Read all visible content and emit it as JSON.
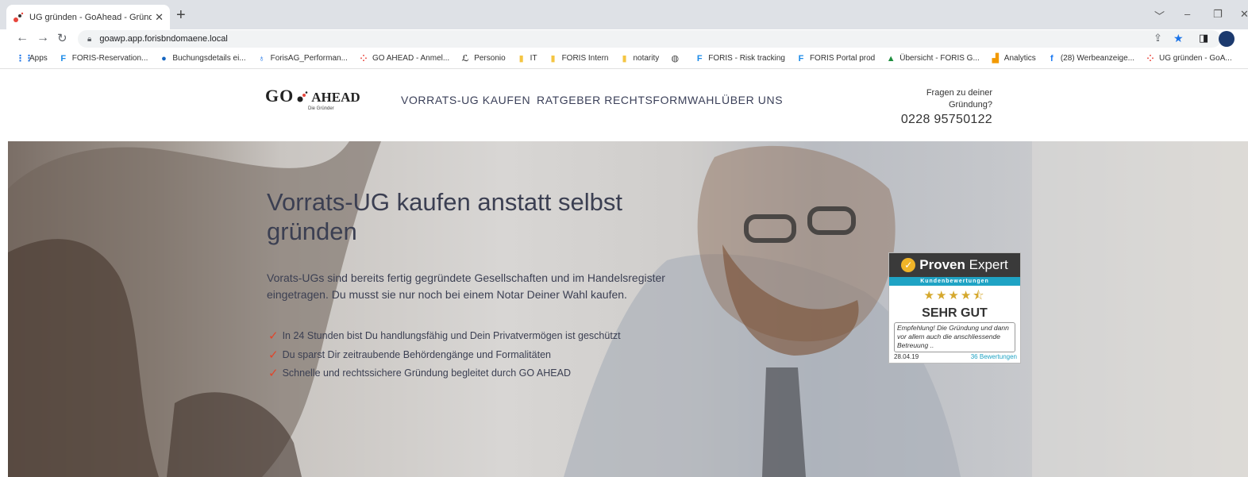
{
  "browser": {
    "tab_title": "UG gründen - GoAhead - Gründ",
    "tab_close": "✕",
    "new_tab": "+",
    "url": "goawp.app.forisbndomaene.local",
    "window_controls": [
      "﹀",
      "–",
      "❐",
      "✕"
    ]
  },
  "bookmarks": [
    {
      "label": "Apps",
      "icon": "apps-grid-icon",
      "color": "#1a73e8",
      "glyph": "⋮⋮"
    },
    {
      "label": "FORIS-Reservation...",
      "icon": "foris-f-icon",
      "color": "#1a8ae8",
      "glyph": "F"
    },
    {
      "label": "Buchungsdetails ei...",
      "icon": "blue-circle-icon",
      "color": "#1565c0",
      "glyph": "●"
    },
    {
      "label": "ForisAG_Performan...",
      "icon": "figure-icon",
      "color": "#1a73e8",
      "glyph": "♁"
    },
    {
      "label": "GO AHEAD - Anmel...",
      "icon": "goahead-dots-icon",
      "color": "#e8453c",
      "glyph": "⁘"
    },
    {
      "label": "Personio",
      "icon": "personio-icon",
      "color": "#444444",
      "glyph": "ℒ"
    },
    {
      "label": "IT",
      "icon": "folder-icon",
      "color": "#f4c542",
      "glyph": "▮"
    },
    {
      "label": "FORIS Intern",
      "icon": "folder-icon",
      "color": "#f4c542",
      "glyph": "▮"
    },
    {
      "label": "notarity",
      "icon": "folder-icon",
      "color": "#f4c542",
      "glyph": "▮"
    },
    {
      "label": "",
      "icon": "globe-icon",
      "color": "#444444",
      "glyph": "◍"
    },
    {
      "label": "FORIS - Risk tracking",
      "icon": "foris-f-icon",
      "color": "#1a8ae8",
      "glyph": "F"
    },
    {
      "label": "FORIS Portal prod",
      "icon": "foris-f-icon",
      "color": "#1a8ae8",
      "glyph": "F"
    },
    {
      "label": "Übersicht - FORIS G...",
      "icon": "drive-icon",
      "color": "#1e8e3e",
      "glyph": "▲"
    },
    {
      "label": "Analytics",
      "icon": "analytics-icon",
      "color": "#f29900",
      "glyph": "▟"
    },
    {
      "label": "(28) Werbeanzeige...",
      "icon": "facebook-icon",
      "color": "#1877f2",
      "glyph": "f"
    },
    {
      "label": "UG gründen - GoA...",
      "icon": "goahead-dots-icon",
      "color": "#e8453c",
      "glyph": "⁘"
    }
  ],
  "site": {
    "logo_go": "GO",
    "logo_ahead": "AHEAD",
    "logo_sub": "Die Gründer",
    "nav": [
      "VORRATS-UG KAUFEN",
      "RATGEBER RECHTSFORMWAHL",
      "ÜBER UNS"
    ],
    "contact_question": "Fragen zu deiner Gründung?",
    "contact_phone": "0228 95750122"
  },
  "hero": {
    "title": "Vorrats-UG kaufen anstatt selbst gründen",
    "text": "Vorats-UGs sind bereits fertig gegründete Gesellschaften und im Handelsregister eingetragen. Du musst sie nur noch bei einem Notar Deiner Wahl kaufen.",
    "bullets": [
      "In 24 Stunden bist Du handlungsfähig und Dein Privatvermögen ist geschützt",
      "Du sparst Dir zeitraubende Behördengänge und Formalitäten",
      "Schnelle und rechtssichere Gründung begleitet durch GO AHEAD"
    ]
  },
  "badge": {
    "brand_bold": "Proven",
    "brand_rest": "Expert",
    "subtitle": "Kundenbewertungen",
    "stars": "★★★★⯪",
    "rating": 4.5,
    "grade": "SEHR GUT",
    "quote": "Empfehlung! Die Gründung und dann vor allem auch die anschliessende Betreuung ..",
    "date": "28.04.19",
    "count": "36 Bewertungen"
  }
}
